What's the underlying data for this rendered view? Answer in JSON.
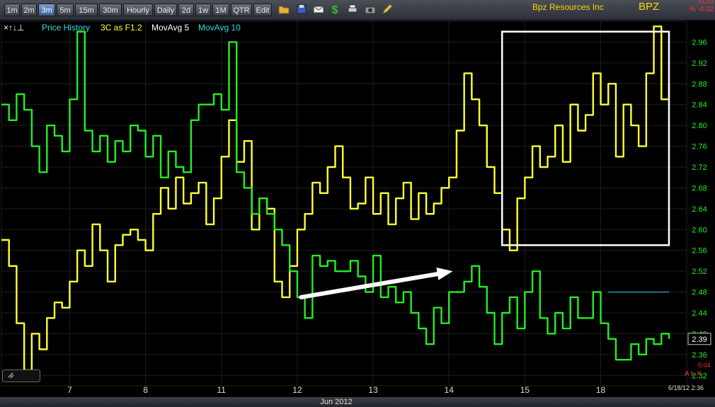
{
  "toolbar": {
    "timeframes": [
      "1m",
      "2m",
      "3m",
      "5m",
      "15m",
      "30m",
      "Hourly",
      "Daily",
      "2d",
      "1w",
      "1M",
      "QTR",
      "Edit"
    ],
    "active": "3m",
    "icons": [
      "folder-icon",
      "save-icon",
      "mail-icon",
      "dollar-icon",
      "print-icon",
      "camera-icon",
      "pencil-icon"
    ]
  },
  "symbol": {
    "name": "Bpz Resources Inc",
    "ticker": "BPZ",
    "change": "-0.10",
    "change_pct": "% -4.02"
  },
  "legend": {
    "arrows": "×↑↓⊥",
    "price_history": "Price History",
    "indicator": "3C as F1.2",
    "ma5": "MovAvg 5",
    "ma10": "MovAvg 10"
  },
  "colors": {
    "price": "#ffff33",
    "indicator": "#22ee22",
    "axis": "#22ee22",
    "ma10": "#33dddd",
    "annotation": "#ffffff"
  },
  "footer": {
    "month": "Jun 2012",
    "timestamp": "6/18/12 2:36",
    "volume_label": "0.04",
    "tools": "A L X"
  },
  "chart_data": {
    "type": "line",
    "title": "Bpz Resources Inc",
    "x_tick_labels": [
      "7",
      "8",
      "11",
      "12",
      "13",
      "14",
      "15",
      "18"
    ],
    "y_ticks": [
      2.32,
      2.36,
      2.4,
      2.44,
      2.48,
      2.52,
      2.56,
      2.6,
      2.64,
      2.68,
      2.72,
      2.76,
      2.8,
      2.84,
      2.88,
      2.92,
      2.96
    ],
    "ylim": [
      2.3,
      3.0
    ],
    "last_price": "2.39",
    "grid": true,
    "series": [
      {
        "name": "Price History",
        "color": "#ffff33",
        "x": [
          0.0,
          0.1,
          0.2,
          0.3,
          0.4,
          0.5,
          0.6,
          0.7,
          0.8,
          0.9,
          1.0,
          1.1,
          1.2,
          1.3,
          1.4,
          1.5,
          1.6,
          1.7,
          1.8,
          1.9,
          2.0,
          2.1,
          2.2,
          2.3,
          2.4,
          2.5,
          2.6,
          2.7,
          2.8,
          2.9,
          3.0,
          3.1,
          3.2,
          3.3,
          3.4,
          3.5,
          3.6,
          3.7,
          3.8,
          3.9,
          4.0,
          4.1,
          4.2,
          4.3,
          4.4,
          4.5,
          4.6,
          4.7,
          4.8,
          4.9,
          5.0,
          5.1,
          5.2,
          5.3,
          5.4,
          5.5,
          5.6,
          5.7,
          5.8,
          5.9,
          6.0,
          6.1,
          6.2,
          6.3,
          6.4,
          6.5,
          6.6,
          6.7,
          6.8,
          6.9,
          7.0,
          7.1,
          7.2,
          7.3,
          7.4,
          7.5,
          7.6,
          7.7,
          7.8,
          7.9,
          8.0,
          8.1,
          8.2,
          8.3,
          8.4,
          8.5,
          8.6,
          8.7,
          8.8
        ],
        "y": [
          2.58,
          2.53,
          2.42,
          2.33,
          2.4,
          2.37,
          2.43,
          2.46,
          2.45,
          2.5,
          2.56,
          2.53,
          2.61,
          2.56,
          2.5,
          2.57,
          2.59,
          2.6,
          2.58,
          2.56,
          2.63,
          2.68,
          2.64,
          2.7,
          2.65,
          2.67,
          2.69,
          2.61,
          2.66,
          2.74,
          2.81,
          2.73,
          2.77,
          2.6,
          2.66,
          2.64,
          2.5,
          2.47,
          2.53,
          2.6,
          2.63,
          2.69,
          2.67,
          2.72,
          2.76,
          2.7,
          2.64,
          2.65,
          2.7,
          2.63,
          2.67,
          2.61,
          2.66,
          2.69,
          2.62,
          2.67,
          2.63,
          2.65,
          2.68,
          2.7,
          2.79,
          2.9,
          2.85,
          2.8,
          2.72,
          2.67,
          2.6,
          2.56,
          2.66,
          2.7,
          2.76,
          2.72,
          2.74,
          2.8,
          2.73,
          2.84,
          2.79,
          2.82,
          2.9,
          2.84,
          2.88,
          2.74,
          2.84,
          2.8,
          2.76,
          2.9,
          2.99,
          2.85,
          2.88
        ]
      },
      {
        "name": "3C as F1.2",
        "color": "#22ee22",
        "x": [
          0.0,
          0.1,
          0.2,
          0.3,
          0.4,
          0.5,
          0.6,
          0.7,
          0.8,
          0.9,
          1.0,
          1.1,
          1.2,
          1.3,
          1.4,
          1.5,
          1.6,
          1.7,
          1.8,
          1.9,
          2.0,
          2.1,
          2.2,
          2.3,
          2.4,
          2.5,
          2.6,
          2.7,
          2.8,
          2.9,
          3.0,
          3.1,
          3.2,
          3.3,
          3.4,
          3.5,
          3.6,
          3.7,
          3.8,
          3.9,
          4.0,
          4.1,
          4.2,
          4.3,
          4.4,
          4.5,
          4.6,
          4.7,
          4.8,
          4.9,
          5.0,
          5.1,
          5.2,
          5.3,
          5.4,
          5.5,
          5.6,
          5.7,
          5.8,
          5.9,
          6.0,
          6.1,
          6.2,
          6.3,
          6.4,
          6.5,
          6.6,
          6.7,
          6.8,
          6.9,
          7.0,
          7.1,
          7.2,
          7.3,
          7.4,
          7.5,
          7.6,
          7.7,
          7.8,
          7.9,
          8.0,
          8.1,
          8.2,
          8.3,
          8.4,
          8.5,
          8.6,
          8.7,
          8.8
        ],
        "y": [
          2.84,
          2.81,
          2.86,
          2.83,
          2.76,
          2.71,
          2.8,
          2.78,
          2.75,
          2.85,
          2.98,
          2.79,
          2.75,
          2.78,
          2.73,
          2.77,
          2.75,
          2.8,
          2.79,
          2.74,
          2.78,
          2.7,
          2.75,
          2.72,
          2.71,
          2.81,
          2.84,
          2.84,
          2.86,
          2.83,
          2.96,
          2.71,
          2.68,
          2.63,
          2.66,
          2.63,
          2.6,
          2.57,
          2.52,
          2.47,
          2.43,
          2.55,
          2.53,
          2.54,
          2.52,
          2.52,
          2.54,
          2.51,
          2.48,
          2.55,
          2.47,
          2.49,
          2.46,
          2.48,
          2.44,
          2.41,
          2.38,
          2.45,
          2.42,
          2.48,
          2.48,
          2.5,
          2.53,
          2.49,
          2.44,
          2.38,
          2.44,
          2.47,
          2.41,
          2.48,
          2.52,
          2.43,
          2.4,
          2.44,
          2.41,
          2.47,
          2.43,
          2.43,
          2.48,
          2.42,
          2.39,
          2.35,
          2.35,
          2.38,
          2.36,
          2.39,
          2.38,
          2.4,
          2.39
        ]
      },
      {
        "name": "MovAvg 10",
        "color": "#33dddd",
        "x": [
          8.0,
          8.8
        ],
        "y": [
          2.48,
          2.48
        ]
      }
    ],
    "annotations": {
      "box": {
        "x": [
          6.6,
          8.8
        ],
        "y": [
          2.57,
          2.98
        ]
      },
      "arrow": {
        "from": [
          3.95,
          2.47
        ],
        "to": [
          5.95,
          2.52
        ]
      }
    }
  }
}
